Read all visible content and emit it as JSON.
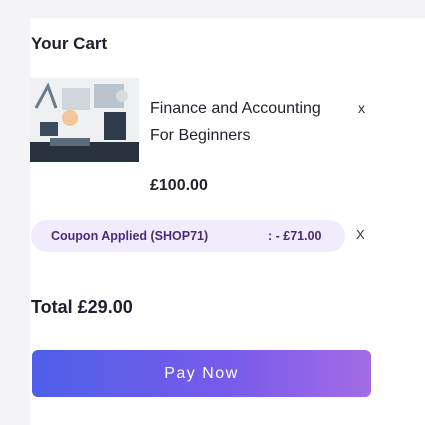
{
  "cart": {
    "title": "Your Cart",
    "item": {
      "name": "Finance and Accounting For Beginners",
      "price": "£100.00",
      "remove": "x",
      "thumbnail_icon": "course-thumbnail-illustration"
    },
    "coupon": {
      "label": "Coupon Applied (SHOP71)",
      "amount": ": - £71.00",
      "remove": "X"
    },
    "total": "Total £29.00",
    "pay_button": "Pay Now"
  },
  "colors": {
    "coupon_bg": "#f1ecfb",
    "coupon_text": "#4a2b7a",
    "button_gradient_start": "#4d5fe8",
    "button_gradient_end": "#a36ce6"
  }
}
